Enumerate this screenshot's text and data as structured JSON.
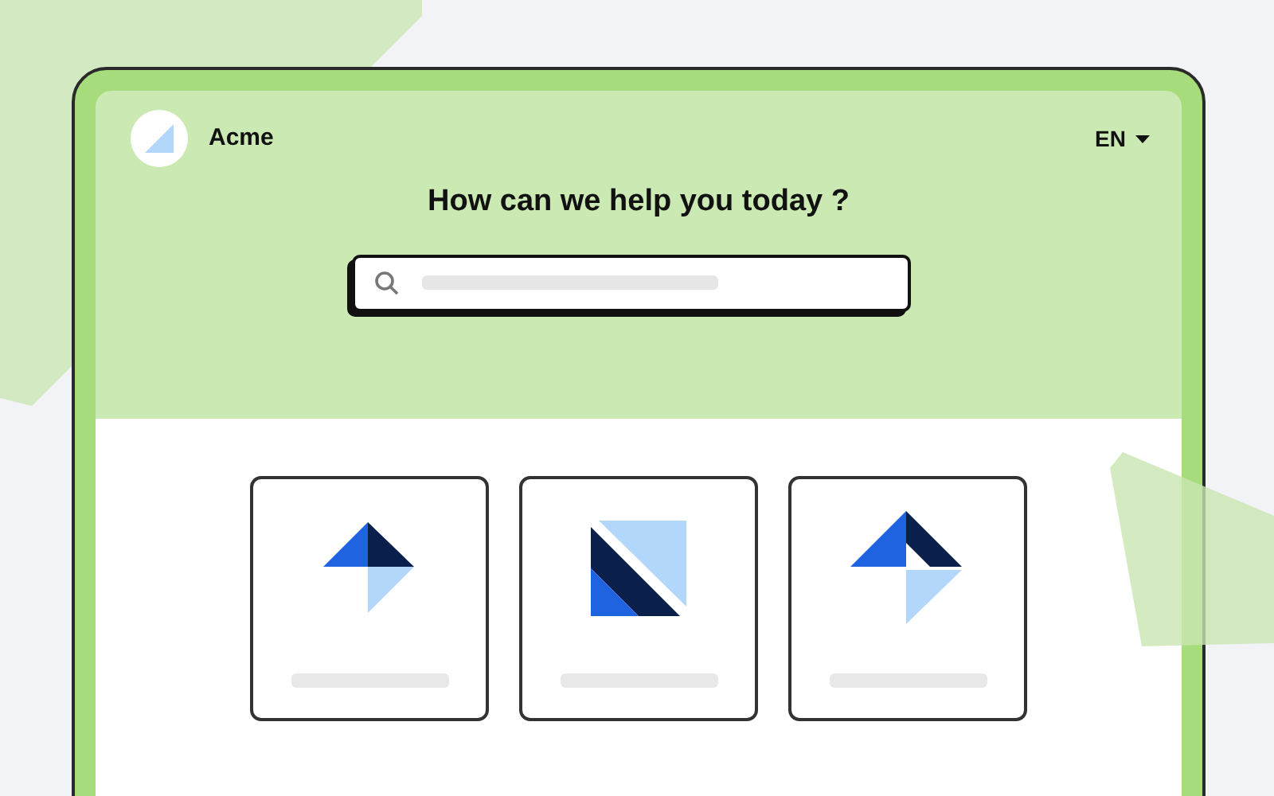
{
  "header": {
    "brand": "Acme",
    "language": "EN"
  },
  "hero": {
    "title": "How can we help you today ?"
  },
  "cards": [
    {
      "kind": "kite"
    },
    {
      "kind": "square"
    },
    {
      "kind": "split-kite"
    }
  ]
}
